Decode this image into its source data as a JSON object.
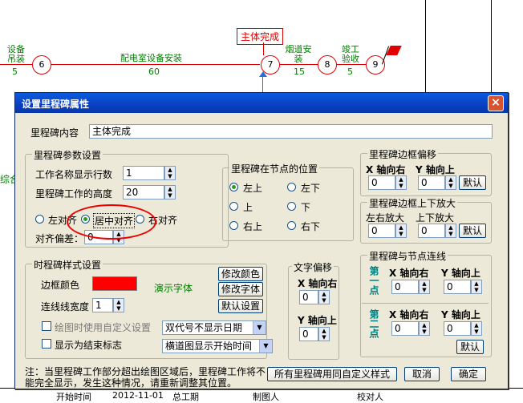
{
  "diagram": {
    "top_left_label": "设备\n吊装",
    "top_left_value": "5",
    "nodes": [
      "6",
      "7",
      "8",
      "9"
    ],
    "task1_label": "配电室设备安装",
    "task1_value": "60",
    "milestone_label": "主体完成",
    "task2_label": "烟道安\n装",
    "task2_value": "15",
    "task3_label": "竣工\n验收",
    "task3_value": "5",
    "left_edge_text": "综合",
    "bottom_row": [
      "开始时间",
      "2012-11-01",
      "总工期",
      "制图人",
      "校对人"
    ]
  },
  "dialog": {
    "title": "设置里程碑属性",
    "close": "×",
    "content_label": "里程碑内容",
    "content_value": "主体完成",
    "params": {
      "title": "里程碑参数设置",
      "rows_label": "工作名称显示行数",
      "rows_value": "1",
      "height_label": "里程碑工作的高度",
      "height_value": "20",
      "align_left": "左对齐",
      "align_center": "居中对齐",
      "align_right": "右对齐",
      "offset_label": "对齐偏差：",
      "offset_value": "0"
    },
    "position": {
      "title": "里程碑在节点的位置",
      "options": [
        "左上",
        "左下",
        "上",
        "下",
        "右上",
        "右下"
      ],
      "selected": "左上"
    },
    "border_offset": {
      "title": "里程碑边框偏移",
      "x_label": "X 轴向右",
      "y_label": "Y 轴向上",
      "x_value": "0",
      "y_value": "0",
      "default_btn": "默认"
    },
    "border_zoom": {
      "title": "里程碑边框上下放大",
      "lr_label": "左右放大",
      "ud_label": "上下放大",
      "lr_value": "0",
      "ud_value": "0",
      "default_btn": "默认"
    },
    "style": {
      "title": "时程碑样式设置",
      "border_color_label": "边框颜色",
      "border_color": "#ff0000",
      "demo_font": "演示字体",
      "line_width_label": "连线线宽度",
      "line_width_value": "1",
      "custom_label": "绘图时使用自定义设置",
      "end_flag_label": "显示为结束标志",
      "modify_color_btn": "修改颜色",
      "modify_font_btn": "修改字体",
      "default_btn": "默认设置",
      "select1": "双代号不显示日期",
      "select2": "横道图显示开始时间"
    },
    "text_offset": {
      "title": "文字偏移",
      "x_label": "X 轴向右",
      "x_value": "0",
      "y_label": "Y 轴向上",
      "y_value": "0"
    },
    "node_link": {
      "title": "里程碑与节点连线",
      "first_label": "第一点",
      "second_label": "第二点",
      "x_label": "X 轴向右",
      "y_label": "Y 轴向上",
      "p1_x": "0",
      "p1_y": "0",
      "p2_x": "0",
      "p2_y": "0",
      "default_btn": "默认"
    },
    "note": "注：当里程碑工作部分超出绘图区域后，里程碑工作将不能完全显示，发生这种情况，请重新调整其位置。",
    "same_custom_btn": "所有里程碑用同自定义样式",
    "cancel_btn": "取消",
    "ok_btn": "确定"
  }
}
